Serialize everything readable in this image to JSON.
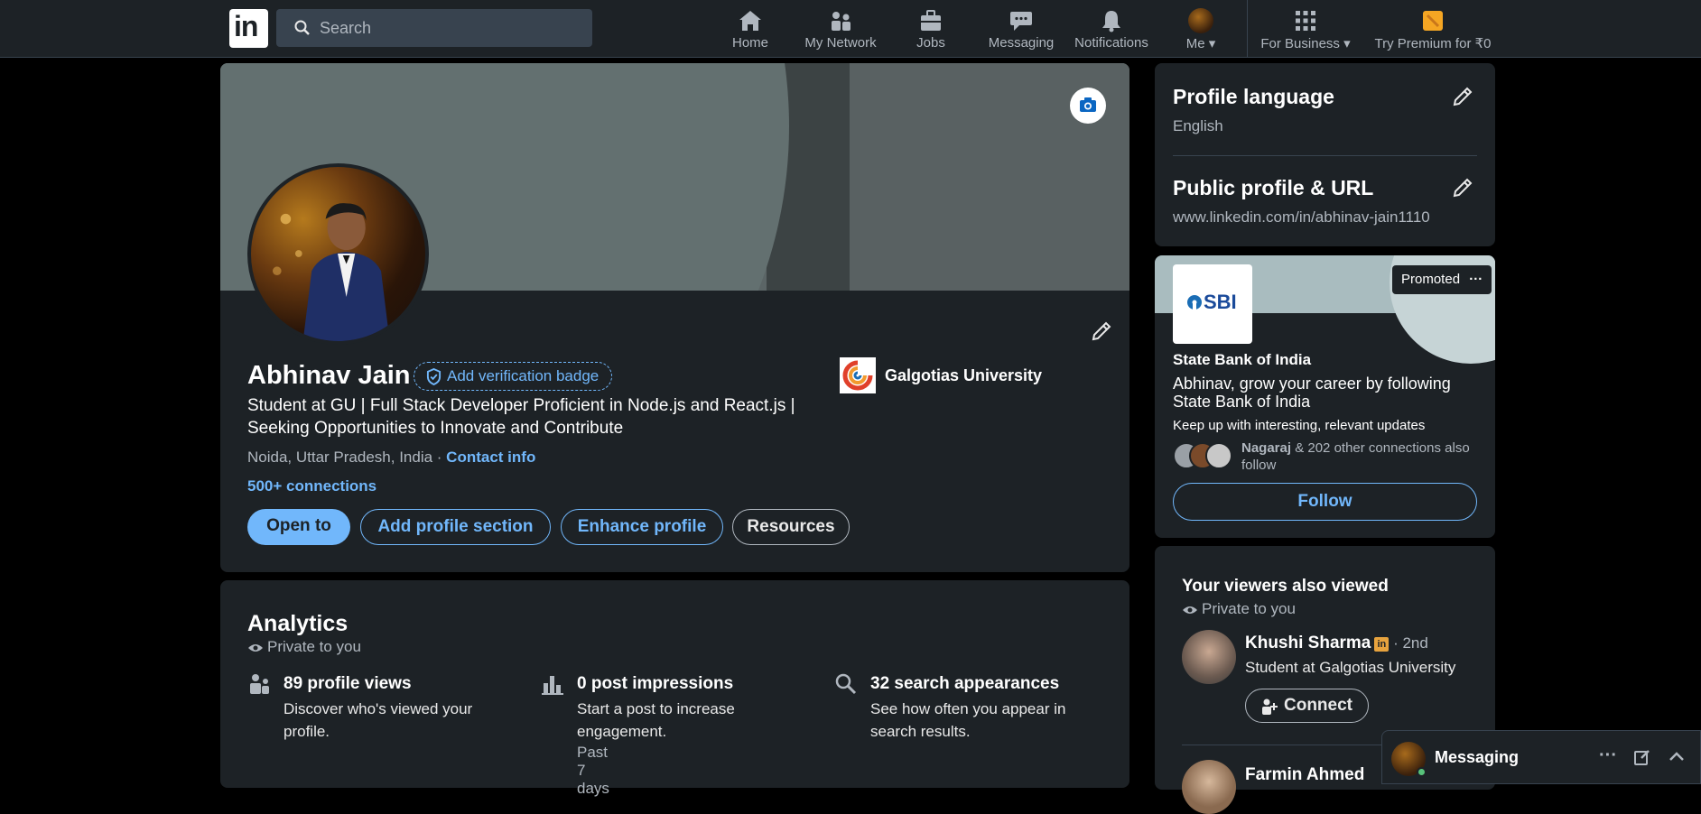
{
  "nav": {
    "logo_text": "in",
    "search_placeholder": "Search",
    "items": [
      {
        "label": "Home",
        "icon": "home-icon"
      },
      {
        "label": "My Network",
        "icon": "network-icon"
      },
      {
        "label": "Jobs",
        "icon": "briefcase-icon"
      },
      {
        "label": "Messaging",
        "icon": "chat-icon"
      },
      {
        "label": "Notifications",
        "icon": "bell-icon"
      },
      {
        "label": "Me",
        "icon": "avatar"
      },
      {
        "label": "For Business",
        "icon": "grid-icon"
      },
      {
        "label": "Try Premium for ₹0",
        "icon": "premium-icon"
      }
    ]
  },
  "profile": {
    "name": "Abhinav Jain",
    "verify_label": "Add verification badge",
    "headline": "Student at GU | Full Stack Developer Proficient in Node.js and React.js | Seeking Opportunities to Innovate and Contribute",
    "location": "Noida, Uttar Pradesh, India · ",
    "contact_info": "Contact info",
    "connections": "500+ connections",
    "school": "Galgotias University",
    "buttons": {
      "open_to": "Open to",
      "add_section": "Add profile section",
      "enhance": "Enhance profile",
      "resources": "Resources"
    }
  },
  "analytics": {
    "title": "Analytics",
    "private": "Private to you",
    "metrics": [
      {
        "title": "89 profile views",
        "desc": "Discover who's viewed your profile.",
        "extra": ""
      },
      {
        "title": "0 post impressions",
        "desc": "Start a post to increase engagement.",
        "extra": "Past 7 days"
      },
      {
        "title": "32 search appearances",
        "desc": "See how often you appear in search results.",
        "extra": ""
      }
    ]
  },
  "settings": {
    "language_title": "Profile language",
    "language_value": "English",
    "url_title": "Public profile & URL",
    "url_value": "www.linkedin.com/in/abhinav-jain1110"
  },
  "ad": {
    "promoted": "Promoted",
    "logo_text": "SBI",
    "company": "State Bank of India",
    "text": "Abhinav, grow your career by following State Bank of India",
    "sub": "Keep up with interesting, relevant updates",
    "conn_name": "Nagaraj",
    "conn_rest": " & 202 other connections also follow",
    "follow": "Follow"
  },
  "viewers": {
    "title": "Your viewers also viewed",
    "private": "Private to you",
    "person1": {
      "name": "Khushi Sharma",
      "degree": " · 2nd",
      "headline": "Student at Galgotias University",
      "badge": "in"
    },
    "connect": "Connect",
    "person2": {
      "name": "Farmin Ahmed"
    }
  },
  "messaging": {
    "title": "Messaging"
  },
  "colors": {
    "accent": "#71b7fb",
    "background": "#000000",
    "card": "#1d2226",
    "premium": "#e7a33e"
  }
}
